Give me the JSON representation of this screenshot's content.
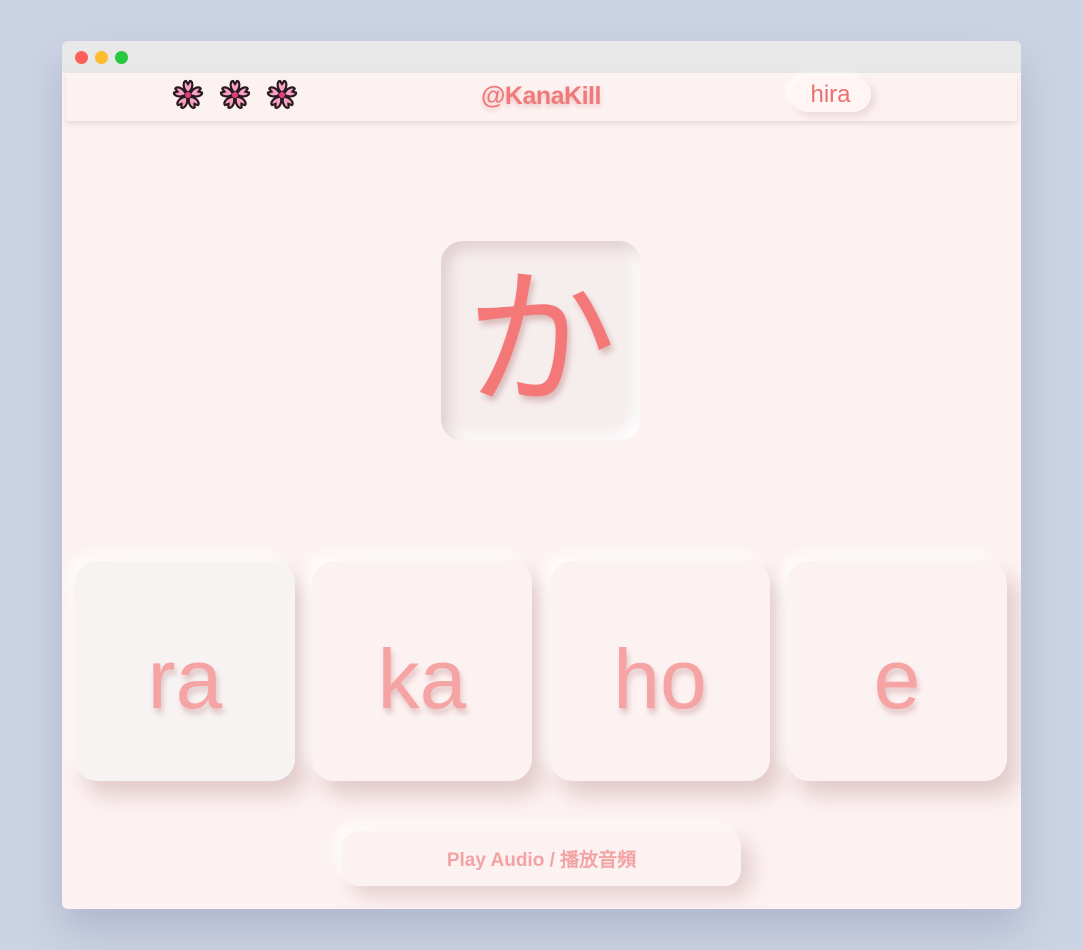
{
  "header": {
    "lives": [
      "cherry-blossom",
      "cherry-blossom",
      "cherry-blossom"
    ],
    "brand": "@KanaKill",
    "mode_label": "hira"
  },
  "quiz": {
    "kana": "か",
    "options": [
      "ra",
      "ka",
      "ho",
      "e"
    ],
    "highlighted_option": "ra"
  },
  "audio": {
    "label": "Play Audio / 播放音頻"
  },
  "colors": {
    "accent": "#f57878",
    "option_text": "#f5a3a3",
    "background": "#fdf2f2",
    "desktop": "#ccd3e4"
  }
}
